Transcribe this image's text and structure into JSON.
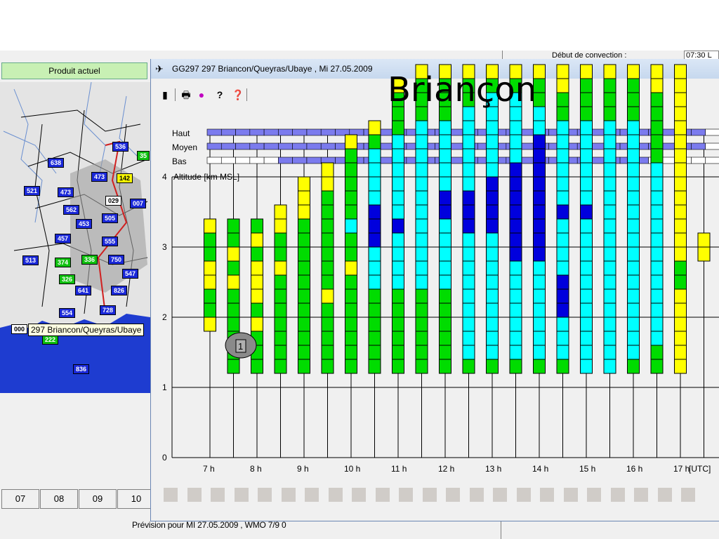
{
  "background_app": {
    "product_header": "Produit actuel",
    "top_right_label": "Début de convection :",
    "top_right_value": "07:30 L",
    "time_buttons": [
      "07",
      "08",
      "09",
      "10"
    ],
    "status_line": "Prévision pour  MI 27.05.2009 , WMO 7/9 0",
    "map_tooltip": "297 Briancon/Queyras/Ubaye",
    "map_stations": [
      {
        "label": "536",
        "color": "blue"
      },
      {
        "label": "35",
        "color": "green"
      },
      {
        "label": "638",
        "color": "blue"
      },
      {
        "label": "473",
        "color": "blue"
      },
      {
        "label": "142",
        "color": "yellow"
      },
      {
        "label": "521",
        "color": "blue"
      },
      {
        "label": "473",
        "color": "blue"
      },
      {
        "label": "029",
        "color": "white"
      },
      {
        "label": "007",
        "color": "blue"
      },
      {
        "label": "562",
        "color": "blue"
      },
      {
        "label": "505",
        "color": "blue"
      },
      {
        "label": "453",
        "color": "blue"
      },
      {
        "label": "457",
        "color": "blue"
      },
      {
        "label": "555",
        "color": "blue"
      },
      {
        "label": "513",
        "color": "blue"
      },
      {
        "label": "374",
        "color": "green"
      },
      {
        "label": "336",
        "color": "green"
      },
      {
        "label": "750",
        "color": "blue"
      },
      {
        "label": "547",
        "color": "blue"
      },
      {
        "label": "326",
        "color": "green"
      },
      {
        "label": "641",
        "color": "blue"
      },
      {
        "label": "826",
        "color": "blue"
      },
      {
        "label": "728",
        "color": "blue"
      },
      {
        "label": "554",
        "color": "blue"
      },
      {
        "label": "000",
        "color": "white"
      },
      {
        "label": "222",
        "color": "green"
      },
      {
        "label": "836",
        "color": "blue"
      }
    ]
  },
  "popup": {
    "title": "GG297  297 Briancon/Queyras/Ubaye , Mi 27.05.2009",
    "toolbar_icons": [
      "pen-icon",
      "printer-icon",
      "info-icon",
      "help-icon",
      "context-help-icon"
    ],
    "overlay_title": "Briançon"
  },
  "colors": {
    "yellow": "#ffff00",
    "green": "#00dc00",
    "cyan": "#00ffff",
    "blue": "#0000dd",
    "cloud_bar": "#7b7bee",
    "cloud_white": "#ffffff",
    "cloud_grey": "#c0c0c0"
  },
  "chart_data": {
    "type": "heatmap",
    "ylabel": "Altitude [km MSL]",
    "xlabel": "[UTC]",
    "ylim": [
      0,
      4
    ],
    "y_ticks": [
      "0",
      "1",
      "2",
      "3",
      "4"
    ],
    "x_ticks": [
      "7 h",
      "8 h",
      "9 h",
      "10 h",
      "11 h",
      "12 h",
      "13 h",
      "14 h",
      "15 h",
      "16 h",
      "17 h"
    ],
    "cloud_layer_labels": [
      "Haut",
      "Moyen",
      "Bas"
    ],
    "cell_height_km": 0.2,
    "columns": [
      {
        "time": 7.0,
        "base_km": 1.8,
        "cells": [
          "Y",
          "G",
          "G",
          "Y",
          "Y",
          "G",
          "G",
          "Y"
        ]
      },
      {
        "time": 7.5,
        "base_km": 1.2,
        "cells": [
          "G",
          "G",
          "G",
          "G",
          "G",
          "G",
          "Y",
          "G",
          "Y",
          "G",
          "G"
        ]
      },
      {
        "time": 8.0,
        "base_km": 1.2,
        "cells": [
          "G",
          "G",
          "G",
          "Y",
          "G",
          "Y",
          "Y",
          "Y",
          "G",
          "Y",
          "G"
        ]
      },
      {
        "time": 8.5,
        "base_km": 1.2,
        "cells": [
          "G",
          "G",
          "G",
          "G",
          "G",
          "G",
          "G",
          "Y",
          "G",
          "G",
          "Y",
          "Y"
        ]
      },
      {
        "time": 9.0,
        "base_km": 1.2,
        "cells": [
          "G",
          "G",
          "G",
          "G",
          "G",
          "G",
          "G",
          "G",
          "G",
          "G",
          "G",
          "Y",
          "Y",
          "Y"
        ]
      },
      {
        "time": 9.5,
        "base_km": 1.2,
        "cells": [
          "G",
          "G",
          "G",
          "G",
          "G",
          "Y",
          "G",
          "G",
          "G",
          "G",
          "G",
          "G",
          "G",
          "Y",
          "Y"
        ]
      },
      {
        "time": 10.0,
        "base_km": 1.2,
        "cells": [
          "G",
          "G",
          "G",
          "G",
          "G",
          "G",
          "G",
          "Y",
          "G",
          "G",
          "C",
          "G",
          "G",
          "G",
          "G",
          "G",
          "Y"
        ]
      },
      {
        "time": 10.5,
        "base_km": 1.2,
        "cells": [
          "G",
          "G",
          "G",
          "G",
          "G",
          "G",
          "C",
          "C",
          "C",
          "B",
          "B",
          "B",
          "C",
          "C",
          "C",
          "C",
          "G",
          "Y"
        ]
      },
      {
        "time": 11.0,
        "base_km": 1.2,
        "cells": [
          "G",
          "G",
          "G",
          "G",
          "G",
          "G",
          "C",
          "C",
          "C",
          "C",
          "B",
          "C",
          "C",
          "C",
          "C",
          "C",
          "C",
          "G",
          "G",
          "G",
          "Y"
        ]
      },
      {
        "time": 11.5,
        "base_km": 1.2,
        "cells": [
          "G",
          "G",
          "G",
          "G",
          "G",
          "G",
          "C",
          "C",
          "C",
          "C",
          "C",
          "C",
          "C",
          "C",
          "C",
          "C",
          "C",
          "C",
          "G",
          "G",
          "G",
          "Y"
        ]
      },
      {
        "time": 12.0,
        "base_km": 1.2,
        "cells": [
          "G",
          "G",
          "G",
          "G",
          "G",
          "G",
          "C",
          "C",
          "C",
          "C",
          "C",
          "B",
          "B",
          "C",
          "C",
          "C",
          "C",
          "C",
          "G",
          "G",
          "G",
          "Y"
        ]
      },
      {
        "time": 12.5,
        "base_km": 1.2,
        "cells": [
          "G",
          "C",
          "C",
          "C",
          "C",
          "C",
          "C",
          "C",
          "C",
          "C",
          "B",
          "B",
          "B",
          "C",
          "C",
          "C",
          "C",
          "C",
          "C",
          "G",
          "G",
          "Y"
        ]
      },
      {
        "time": 13.0,
        "base_km": 1.2,
        "cells": [
          "G",
          "C",
          "C",
          "C",
          "C",
          "C",
          "C",
          "C",
          "C",
          "C",
          "B",
          "B",
          "B",
          "B",
          "C",
          "C",
          "C",
          "C",
          "C",
          "C",
          "G",
          "Y"
        ]
      },
      {
        "time": 13.5,
        "base_km": 1.2,
        "cells": [
          "G",
          "C",
          "C",
          "C",
          "C",
          "C",
          "C",
          "C",
          "B",
          "B",
          "B",
          "B",
          "B",
          "B",
          "B",
          "C",
          "C",
          "C",
          "C",
          "C",
          "G",
          "Y"
        ]
      },
      {
        "time": 14.0,
        "base_km": 1.2,
        "cells": [
          "G",
          "C",
          "C",
          "C",
          "C",
          "C",
          "C",
          "C",
          "B",
          "B",
          "B",
          "B",
          "B",
          "B",
          "B",
          "B",
          "B",
          "C",
          "C",
          "G",
          "G",
          "Y"
        ]
      },
      {
        "time": 14.5,
        "base_km": 1.2,
        "cells": [
          "G",
          "C",
          "C",
          "C",
          "B",
          "B",
          "B",
          "C",
          "C",
          "C",
          "C",
          "B",
          "C",
          "C",
          "C",
          "C",
          "C",
          "C",
          "G",
          "G",
          "Y",
          "Y"
        ]
      },
      {
        "time": 15.0,
        "base_km": 1.2,
        "cells": [
          "C",
          "C",
          "C",
          "C",
          "C",
          "C",
          "C",
          "C",
          "C",
          "C",
          "C",
          "B",
          "C",
          "C",
          "C",
          "C",
          "C",
          "C",
          "G",
          "G",
          "G",
          "Y"
        ]
      },
      {
        "time": 15.5,
        "base_km": 1.2,
        "cells": [
          "C",
          "C",
          "C",
          "C",
          "C",
          "C",
          "C",
          "C",
          "C",
          "C",
          "C",
          "C",
          "C",
          "C",
          "C",
          "C",
          "C",
          "C",
          "G",
          "G",
          "G",
          "Y"
        ]
      },
      {
        "time": 16.0,
        "base_km": 1.2,
        "cells": [
          "G",
          "C",
          "C",
          "C",
          "C",
          "C",
          "C",
          "C",
          "C",
          "C",
          "C",
          "C",
          "C",
          "C",
          "C",
          "C",
          "C",
          "C",
          "G",
          "G",
          "G",
          "Y"
        ]
      },
      {
        "time": 16.5,
        "base_km": 1.2,
        "cells": [
          "G",
          "G",
          "C",
          "C",
          "C",
          "C",
          "C",
          "C",
          "C",
          "C",
          "C",
          "C",
          "C",
          "C",
          "C",
          "G",
          "G",
          "G",
          "G",
          "G",
          "Y",
          "Y"
        ]
      },
      {
        "time": 17.0,
        "base_km": 1.2,
        "cells": [
          "Y",
          "Y",
          "Y",
          "Y",
          "Y",
          "Y",
          "G",
          "G",
          "Y",
          "Y",
          "Y",
          "Y",
          "Y",
          "Y",
          "Y",
          "Y",
          "Y",
          "Y",
          "Y",
          "Y",
          "Y",
          "Y"
        ]
      },
      {
        "time": 17.5,
        "base_km": 2.8,
        "cells": [
          "Y",
          "Y"
        ]
      }
    ],
    "cloud_layers": {
      "Haut": {
        "fill_fraction": 0.97
      },
      "Moyen": {
        "fill_fraction": 0.97
      },
      "Bas": {
        "fill_fraction": 0.85
      }
    },
    "marker_label": "1"
  }
}
